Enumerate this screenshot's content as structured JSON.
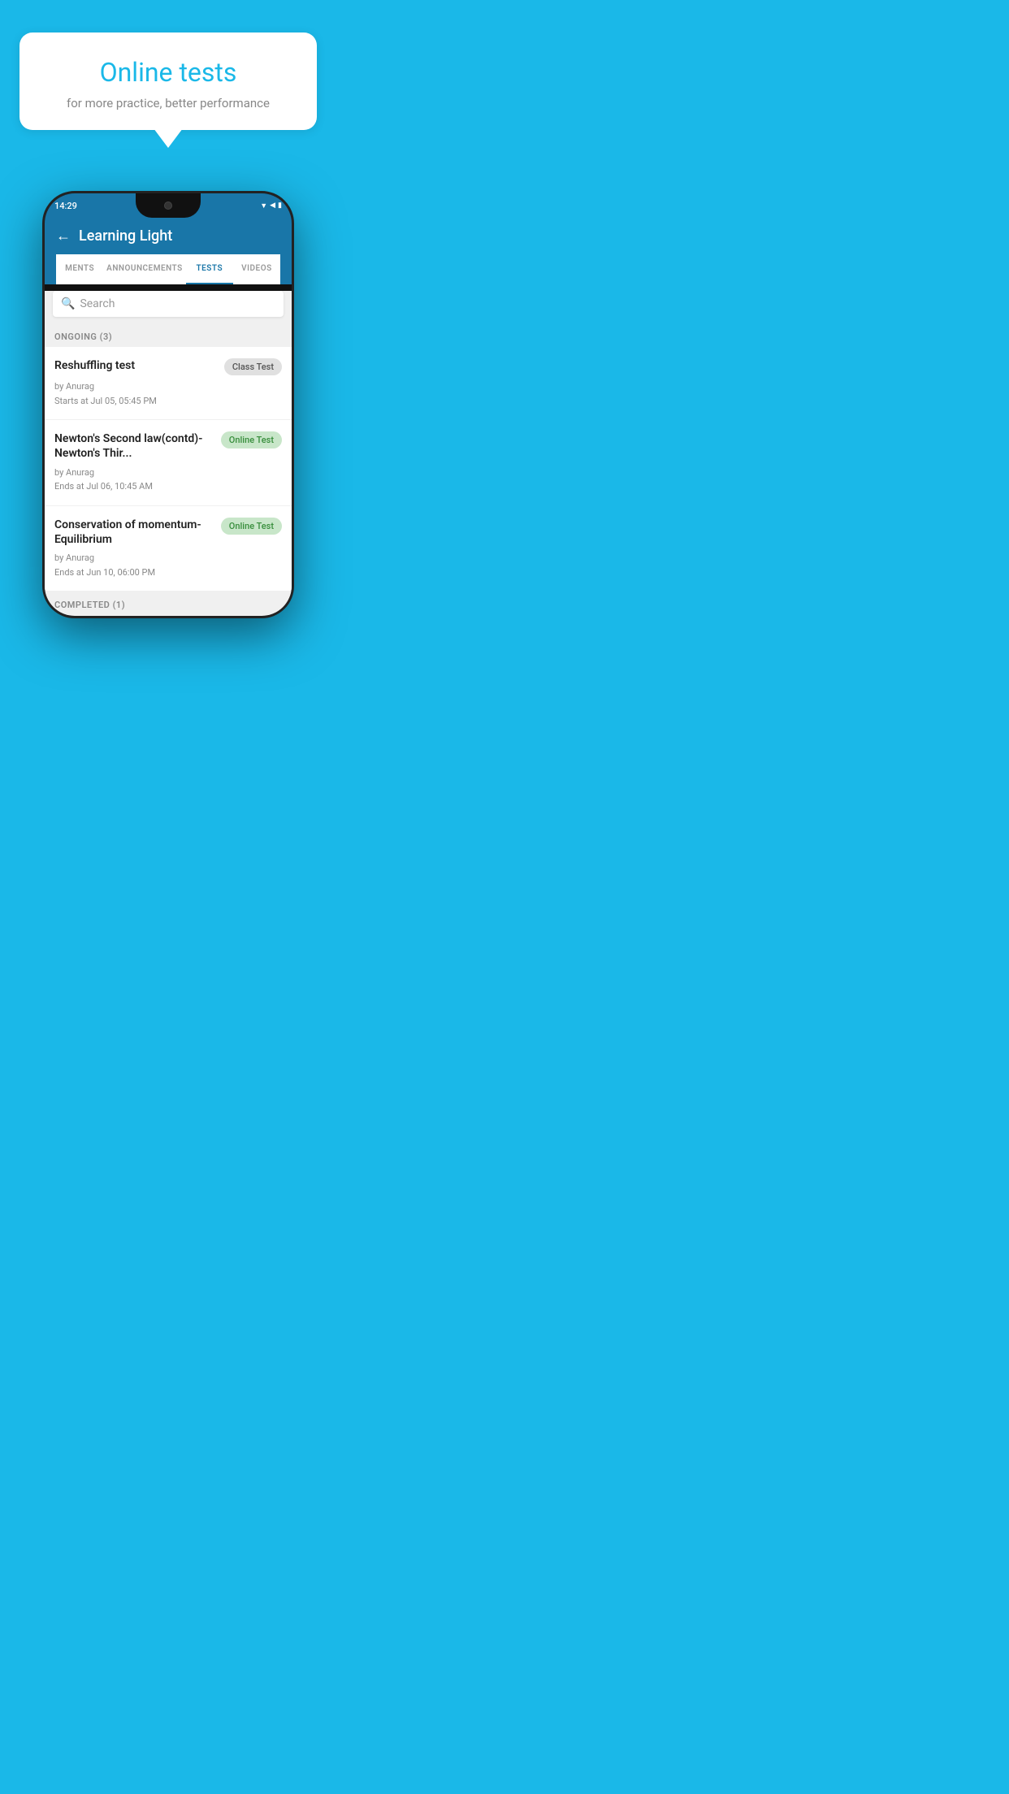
{
  "background_color": "#1ab8e8",
  "speech_bubble": {
    "title": "Online tests",
    "subtitle": "for more practice, better performance"
  },
  "phone": {
    "status_bar": {
      "time": "14:29",
      "icons": [
        "▼",
        "◀",
        "▮"
      ]
    },
    "header": {
      "back_label": "←",
      "title": "Learning Light"
    },
    "tabs": [
      {
        "label": "MENTS",
        "active": false
      },
      {
        "label": "ANNOUNCEMENTS",
        "active": false
      },
      {
        "label": "TESTS",
        "active": true
      },
      {
        "label": "VIDEOS",
        "active": false
      }
    ],
    "search": {
      "placeholder": "Search",
      "icon": "🔍"
    },
    "ongoing_section": {
      "label": "ONGOING (3)",
      "tests": [
        {
          "title": "Reshuffling test",
          "badge": "Class Test",
          "badge_type": "class",
          "by": "by Anurag",
          "date": "Starts at  Jul 05, 05:45 PM"
        },
        {
          "title": "Newton's Second law(contd)-Newton's Thir...",
          "badge": "Online Test",
          "badge_type": "online",
          "by": "by Anurag",
          "date": "Ends at  Jul 06, 10:45 AM"
        },
        {
          "title": "Conservation of momentum-Equilibrium",
          "badge": "Online Test",
          "badge_type": "online",
          "by": "by Anurag",
          "date": "Ends at  Jun 10, 06:00 PM"
        }
      ]
    },
    "completed_section": {
      "label": "COMPLETED (1)"
    }
  }
}
